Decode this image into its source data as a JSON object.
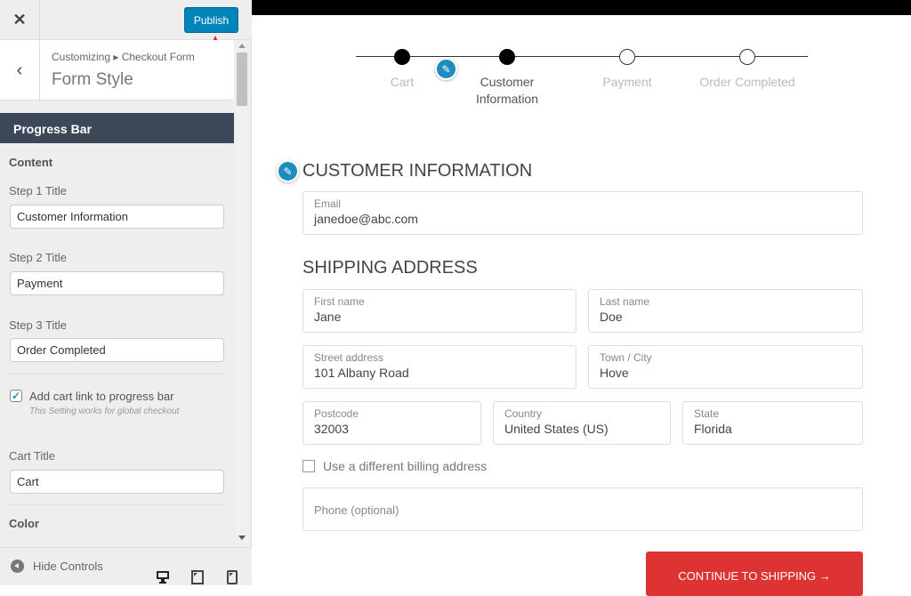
{
  "sidebar": {
    "publish_label": "Publish",
    "breadcrumb": "Customizing ▸ Checkout Form",
    "panel_title": "Form Style",
    "section_title": "Progress Bar",
    "content_label": "Content",
    "step1": {
      "label": "Step 1 Title",
      "value": "Customer Information"
    },
    "step2": {
      "label": "Step 2 Title",
      "value": "Payment"
    },
    "step3": {
      "label": "Step 3 Title",
      "value": "Order Completed"
    },
    "cart_link": {
      "label": "Add cart link to progress bar",
      "note": "This Setting works for global checkout",
      "checked": true
    },
    "cart_title": {
      "label": "Cart Title",
      "value": "Cart"
    },
    "color_label": "Color",
    "hide_controls": "Hide Controls"
  },
  "preview": {
    "steps": [
      {
        "label": "Cart",
        "state": "done"
      },
      {
        "label": "Customer Information",
        "state": "active"
      },
      {
        "label": "Payment",
        "state": "pending"
      },
      {
        "label": "Order Completed",
        "state": "pending"
      }
    ],
    "customer_heading": "CUSTOMER INFORMATION",
    "shipping_heading": "SHIPPING ADDRESS",
    "fields": {
      "email": {
        "label": "Email",
        "value": "janedoe@abc.com"
      },
      "first_name": {
        "label": "First name",
        "value": "Jane"
      },
      "last_name": {
        "label": "Last name",
        "value": "Doe"
      },
      "street": {
        "label": "Street address",
        "value": "101 Albany Road"
      },
      "city": {
        "label": "Town / City",
        "value": "Hove"
      },
      "postcode": {
        "label": "Postcode",
        "value": "32003"
      },
      "country": {
        "label": "Country",
        "value": "United States (US)"
      },
      "state": {
        "label": "State",
        "value": "Florida"
      },
      "phone": {
        "placeholder": "Phone (optional)"
      }
    },
    "billing_label": "Use a different billing address",
    "continue_label": "CONTINUE TO SHIPPING →"
  },
  "colors": {
    "accent": "#0085ba",
    "header": "#3c4858",
    "button": "#dd3333",
    "edit": "#1e8cbe"
  }
}
